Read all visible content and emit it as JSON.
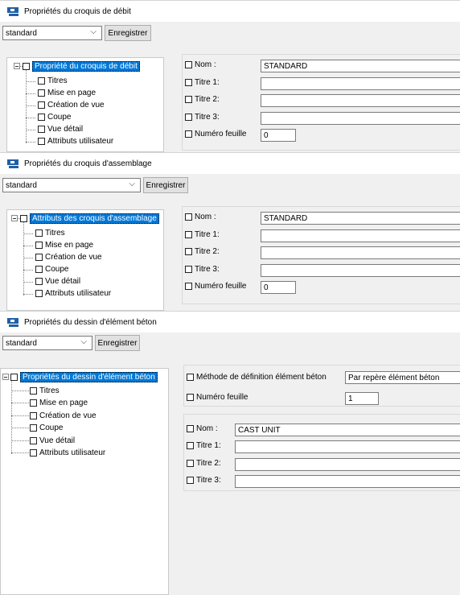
{
  "window1": {
    "title": "Propriétés du croquis de débit",
    "preset": "standard",
    "save_label": "Enregistrer",
    "tree": {
      "root": "Propriété du croquis de débit",
      "children": [
        "Titres",
        "Mise en page",
        "Création de vue",
        "Coupe",
        "Vue détail",
        "Attributs utilisateur"
      ]
    },
    "fields": [
      {
        "label": "Nom :",
        "value": "STANDARD"
      },
      {
        "label": "Titre 1:",
        "value": ""
      },
      {
        "label": "Titre 2:",
        "value": ""
      },
      {
        "label": "Titre 3:",
        "value": ""
      },
      {
        "label": "Numéro feuille",
        "value": "0"
      }
    ]
  },
  "window2": {
    "title": "Propriétés du croquis d'assemblage",
    "preset": "standard",
    "save_label": "Enregistrer",
    "tree": {
      "root": "Attributs des croquis d'assemblage",
      "children": [
        "Titres",
        "Mise en page",
        "Création de vue",
        "Coupe",
        "Vue détail",
        "Attributs utilisateur"
      ]
    },
    "fields": [
      {
        "label": "Nom :",
        "value": "STANDARD"
      },
      {
        "label": "Titre 1:",
        "value": ""
      },
      {
        "label": "Titre 2:",
        "value": ""
      },
      {
        "label": "Titre 3:",
        "value": ""
      },
      {
        "label": "Numéro feuille",
        "value": "0"
      }
    ]
  },
  "window3": {
    "title": "Propriétés du dessin d'élément béton",
    "preset": "standard",
    "save_label": "Enregistrer",
    "tree": {
      "root": "Propriétés du dessin d'élément béton",
      "children": [
        "Titres",
        "Mise en page",
        "Création de vue",
        "Coupe",
        "Vue détail",
        "Attributs utilisateur"
      ]
    },
    "method": {
      "label": "Méthode de définition élément béton",
      "value": "Par repère élément béton"
    },
    "sheet": {
      "label": "Numéro feuille",
      "value": "1"
    },
    "fields": [
      {
        "label": "Nom :",
        "value": "CAST UNIT"
      },
      {
        "label": "Titre 1:",
        "value": ""
      },
      {
        "label": "Titre 2:",
        "value": ""
      },
      {
        "label": "Titre 3:",
        "value": ""
      }
    ]
  }
}
